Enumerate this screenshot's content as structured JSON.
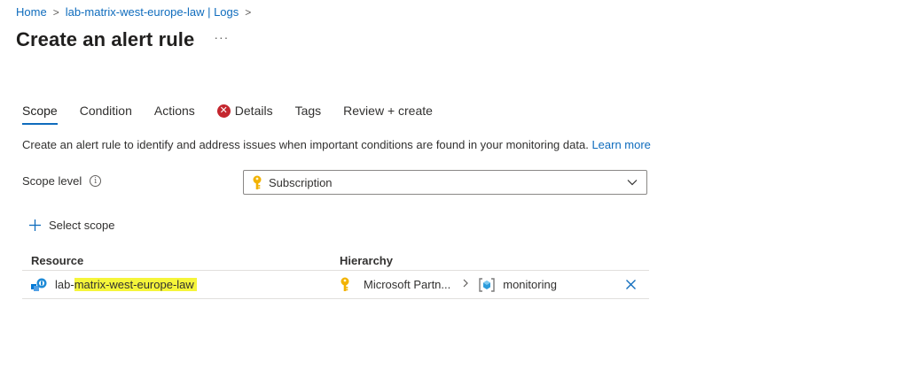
{
  "breadcrumb": {
    "items": [
      "Home",
      "lab-matrix-west-europe-law | Logs"
    ],
    "separator": ">"
  },
  "page": {
    "title": "Create an alert rule",
    "more_label": "···"
  },
  "tabs": [
    {
      "label": "Scope",
      "active": true
    },
    {
      "label": "Condition"
    },
    {
      "label": "Actions"
    },
    {
      "label": "Details",
      "error": true
    },
    {
      "label": "Tags"
    },
    {
      "label": "Review + create"
    }
  ],
  "description": {
    "text": "Create an alert rule to identify and address issues when important conditions are found in your monitoring data.",
    "learn_more": "Learn more"
  },
  "scope_level": {
    "label": "Scope level",
    "info_glyph": "i",
    "selected_value": "Subscription"
  },
  "select_scope": {
    "label": "Select scope"
  },
  "resource_table": {
    "headers": {
      "resource": "Resource",
      "hierarchy": "Hierarchy"
    },
    "rows": [
      {
        "resource_prefix": "lab-",
        "resource_highlighted": "matrix-west-europe-law",
        "hierarchy_parent": "Microsoft Partn...",
        "hierarchy_child": "monitoring"
      }
    ]
  },
  "colors": {
    "link": "#0f6cbd",
    "error": "#c4262e",
    "highlight": "#f5f53a",
    "key": "#f2b200"
  }
}
